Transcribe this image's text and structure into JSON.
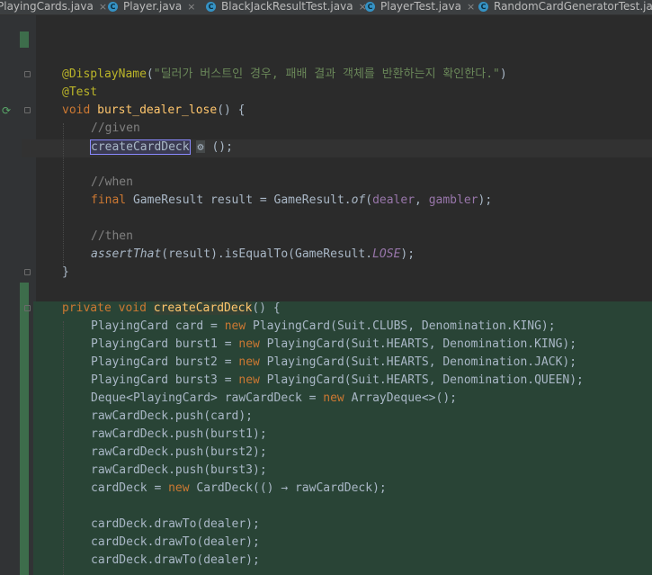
{
  "tabs": [
    {
      "label": "PlayingCards.java",
      "icon": "java-file-icon"
    },
    {
      "label": "Player.java",
      "icon": "java-class-icon"
    },
    {
      "label": "BlackJackResultTest.java",
      "icon": "java-class-icon"
    },
    {
      "label": "PlayerTest.java",
      "icon": "java-class-icon"
    },
    {
      "label": "RandomCardGeneratorTest.java",
      "icon": "java-class-icon"
    }
  ],
  "tab_close": "×",
  "code": {
    "display_name_ann": "@DisplayName",
    "display_name_str": "\"딜러가 버스트인 경우, 패배 결과 객체를 반환하는지 확인한다.\"",
    "test_ann": "@Test",
    "method_void": "void",
    "method_name": "burst_dealer_lose",
    "given_comment": "//given",
    "call_name": "createCardDeck",
    "when_comment": "//when",
    "final_kw": "final",
    "result_stmt_a": " GameResult result = GameResult.",
    "of_method": "of",
    "dealer_var": "dealer",
    "gambler_var": "gambler",
    "then_comment": "//then",
    "assert_that": "assertThat",
    "assert_rest_a": "(result).isEqualTo(GameResult.",
    "lose_const": "LOSE",
    "private_kw": "private",
    "decl_void": "void",
    "decl_name": "createCardDeck",
    "new_kw": "new",
    "card_decl_a": "PlayingCard card = ",
    "card_decl_b": " PlayingCard(Suit.CLUBS, Denomination.KING);",
    "burst1_a": "PlayingCard burst1 = ",
    "burst1_b": " PlayingCard(Suit.HEARTS, Denomination.KING);",
    "burst2_a": "PlayingCard burst2 = ",
    "burst2_b": " PlayingCard(Suit.HEARTS, Denomination.JACK);",
    "burst3_a": "PlayingCard burst3 = ",
    "burst3_b": " PlayingCard(Suit.HEARTS, Denomination.QUEEN);",
    "deque_a": "Deque<PlayingCard> rawCardDeck = ",
    "deque_b": " ArrayDeque<>();",
    "push_card": "rawCardDeck.push(card);",
    "push_b1": "rawCardDeck.push(burst1);",
    "push_b2": "rawCardDeck.push(burst2);",
    "push_b3": "rawCardDeck.push(burst3);",
    "carddeck_a": "cardDeck = ",
    "carddeck_b": " CardDeck(() → rawCardDeck);",
    "draw_dealer": "cardDeck.drawTo(dealer);"
  }
}
